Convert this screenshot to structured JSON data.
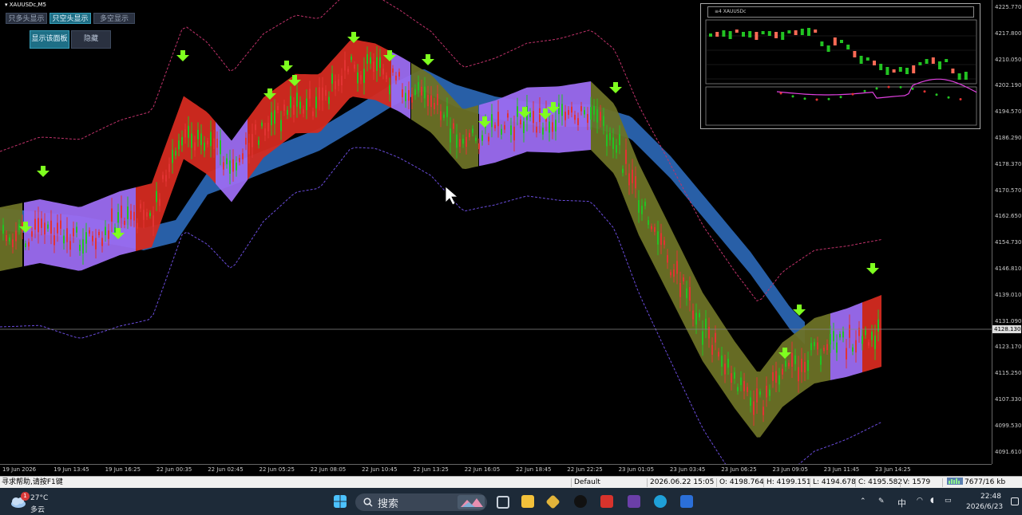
{
  "chart": {
    "symbol": "XAUUSDc,M5",
    "current_price": "4128.130",
    "price_labels": [
      "4225.770",
      "4217.800",
      "4210.050",
      "4202.190",
      "4194.570",
      "4186.290",
      "4178.370",
      "4170.570",
      "4162.650",
      "4154.730",
      "4146.810",
      "4139.010",
      "4131.090",
      "4123.170",
      "4115.250",
      "4107.330",
      "4099.530",
      "4091.610"
    ],
    "time_labels": [
      "19 Jun 2026",
      "19 Jun 13:45",
      "19 Jun 16:25",
      "22 Jun 00:35",
      "22 Jun 02:45",
      "22 Jun 05:25",
      "22 Jun 08:05",
      "22 Jun 10:45",
      "22 Jun 13:25",
      "22 Jun 16:05",
      "22 Jun 18:45",
      "22 Jun 22:25",
      "23 Jun 01:05",
      "23 Jun 03:45",
      "23 Jun 06:25",
      "23 Jun 09:05",
      "23 Jun 11:45",
      "23 Jun 14:25"
    ]
  },
  "panel": {
    "buttons": [
      "只多头显示",
      "只空头显示",
      "多空显示"
    ],
    "show_panel": "显示该面板",
    "hide": "隐藏"
  },
  "mini_chart": {
    "title": "≡4 XAUUSDc"
  },
  "status_bar": {
    "help": "寻求帮助,请按F1键",
    "profile": "Default",
    "datetime": "2026.06.22 15:05",
    "open": "O: 4198.764",
    "high": "H: 4199.151",
    "low": "L: 4194.678",
    "close": "C: 4195.582",
    "volume": "V: 1579",
    "traffic": "7677/16 kb"
  },
  "taskbar": {
    "weather_temp": "27°C",
    "weather_desc": "多云",
    "weather_badge": "1",
    "search_placeholder": "搜索",
    "ime": "中",
    "time": "22:48",
    "date": "2026/6/23"
  },
  "colors": {
    "bull_band": "#9b6cf0",
    "bear_band": "#d42a20",
    "olive_band": "#6b7126",
    "blue_band": "#2a64b0",
    "candle_up": "#22c322",
    "candle_down": "#e23333",
    "arrow": "#7fff1f"
  }
}
